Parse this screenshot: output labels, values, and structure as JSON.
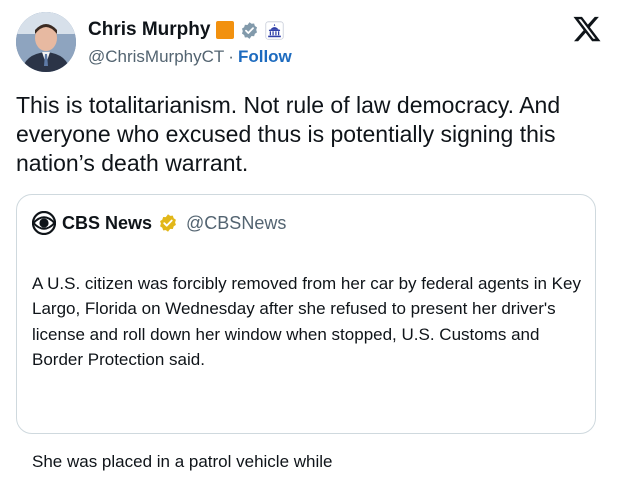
{
  "author": {
    "name": "Chris Murphy",
    "handle": "@ChrisMurphyCT",
    "separator": "·",
    "follow_label": "Follow"
  },
  "tweet": {
    "text": "This is totalitarianism. Not rule of law democracy. And everyone who excused thus is potentially signing this nation’s death warrant."
  },
  "quoted": {
    "name": "CBS News",
    "handle": "@CBSNews",
    "paragraph1": "A U.S. citizen was forcibly removed from her car by federal agents in Key Largo, Florida on Wednesday after she refused to present her driver's license and roll down her window when stopped, U.S. Customs and Border Protection said.",
    "paragraph2": "She was placed in a patrol vehicle while"
  },
  "colors": {
    "link": "#1d6bbf",
    "secondary_text": "#536471",
    "orange_badge": "#f2910f",
    "verified_grey": "#829aab",
    "gold_badge": "#e2b719",
    "border": "#cfd9de"
  },
  "icons": {
    "logo": "x-logo-icon",
    "verified": "verified-badge-icon",
    "capitol": "government-affiliation-icon",
    "cbs": "cbs-eye-logo-icon"
  }
}
